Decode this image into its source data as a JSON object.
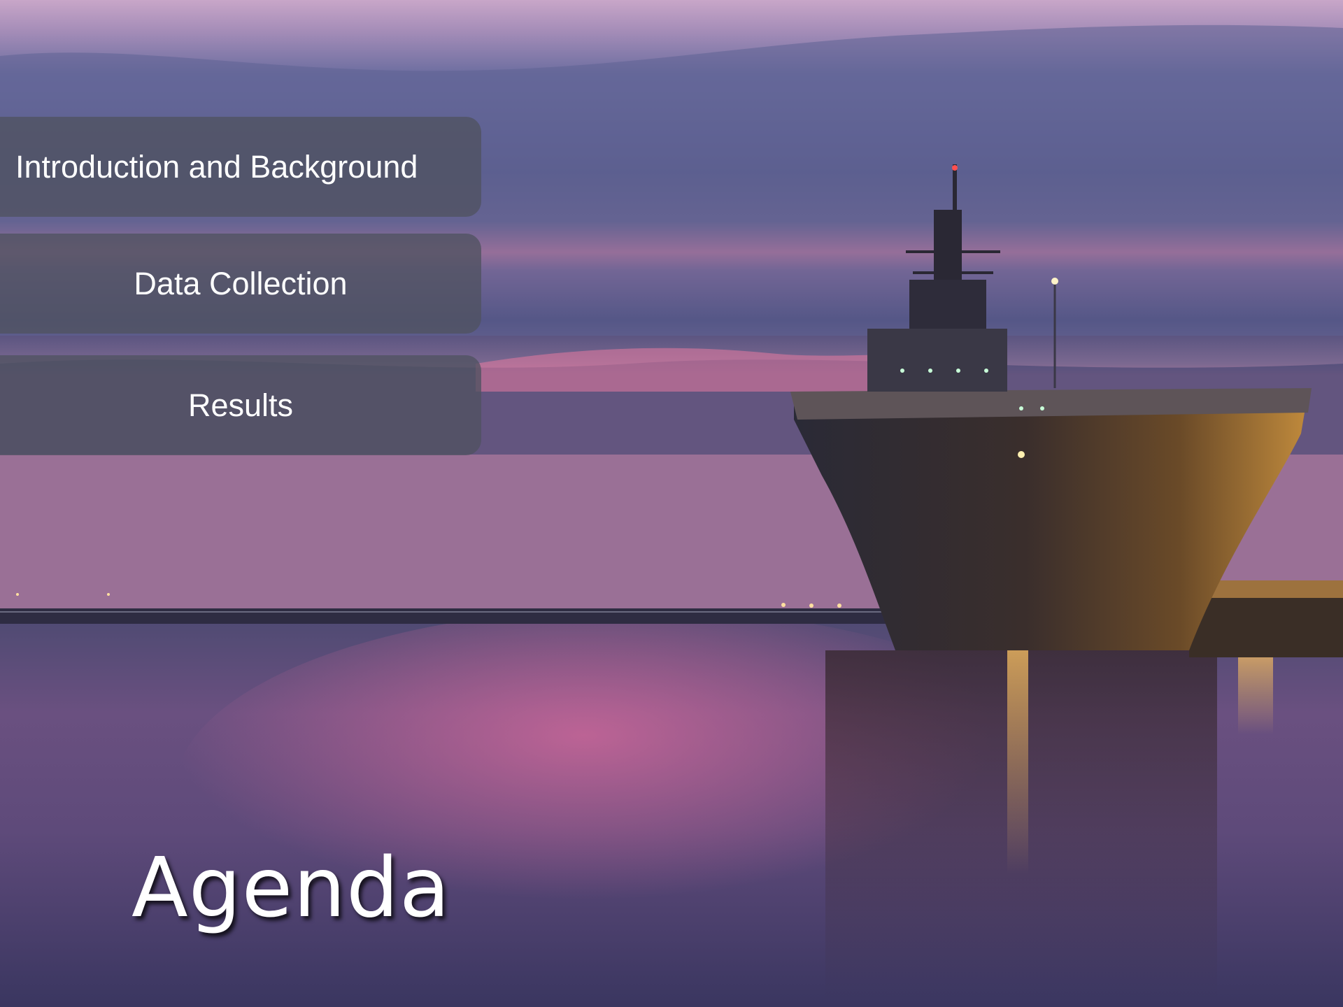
{
  "slide": {
    "title": "Agenda",
    "items": [
      {
        "label": "Introduction and Background"
      },
      {
        "label": "Data Collection"
      },
      {
        "label": "Results"
      }
    ]
  },
  "colors": {
    "panel": "#50526099",
    "sky_top": "#6f6a9a",
    "sunset": "#e66e98",
    "water": "#3a3660"
  },
  "icons": {
    "background": "ship-at-dusk-photo"
  }
}
